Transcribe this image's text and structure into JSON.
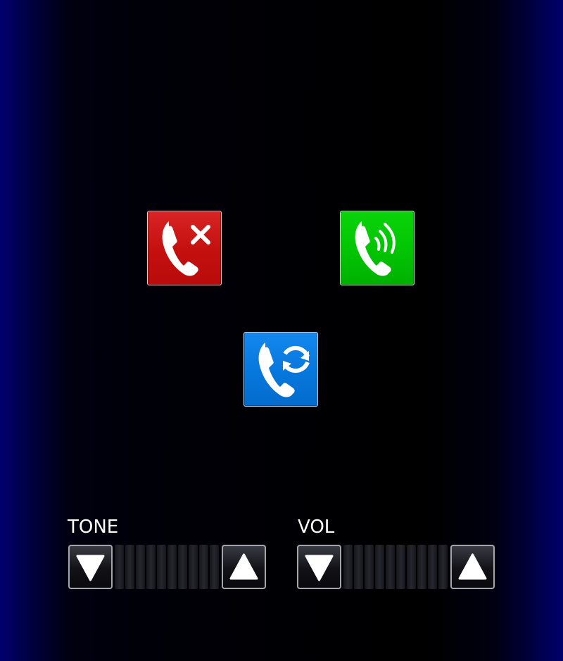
{
  "call_buttons": {
    "reject": {
      "icon": "phone-reject-icon",
      "color": "#c81414"
    },
    "answer": {
      "icon": "phone-answer-icon",
      "color": "#05c205"
    },
    "swap": {
      "icon": "phone-swap-icon",
      "color": "#0a78dc"
    }
  },
  "tone": {
    "label": "TONE",
    "down_icon": "triangle-down-icon",
    "up_icon": "triangle-up-icon",
    "segments": 10
  },
  "vol": {
    "label": "VOL",
    "down_icon": "triangle-down-icon",
    "up_icon": "triangle-up-icon",
    "segments": 10
  }
}
